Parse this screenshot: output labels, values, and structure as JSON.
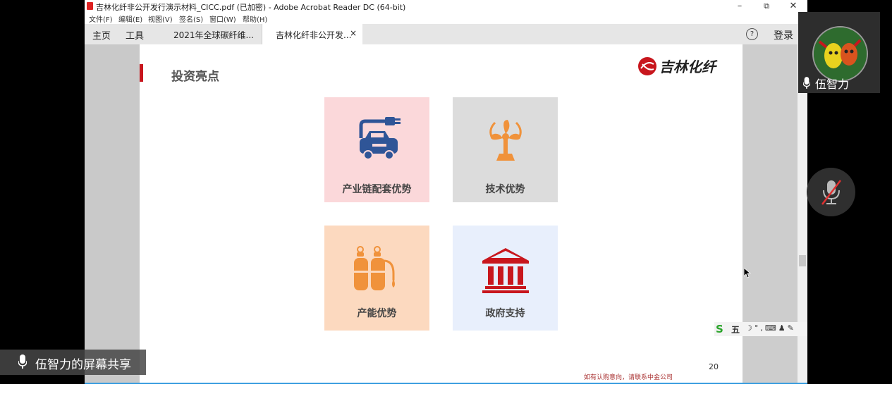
{
  "window": {
    "title": "吉林化纤非公开发行演示材料_CICC.pdf  (已加密)  - Adobe Acrobat Reader DC (64-bit)",
    "controls": {
      "minimize": "–",
      "restore": "⧉",
      "close": "✕"
    }
  },
  "menu": [
    "文件(F)",
    "编辑(E)",
    "视图(V)",
    "签名(S)",
    "窗口(W)",
    "帮助(H)"
  ],
  "toolbar": {
    "home": "主页",
    "tools": "工具",
    "help": "?",
    "login": "登录"
  },
  "tabs": [
    {
      "label": "2021年全球碳纤维..."
    },
    {
      "label": "吉林化纤非公开发...",
      "close": "×"
    }
  ],
  "page": {
    "title": "投资亮点",
    "logo_text": "吉林化纤",
    "cards": [
      {
        "label": "产业链配套优势",
        "icon": "car-charging-icon",
        "color": "#2f5597"
      },
      {
        "label": "技术优势",
        "icon": "fan-icon",
        "color": "#f0923b"
      },
      {
        "label": "产能优势",
        "icon": "gas-cylinder-icon",
        "color": "#f0923b"
      },
      {
        "label": "政府支持",
        "icon": "government-building-icon",
        "color": "#c8161d"
      }
    ],
    "footnote": "如有认购意向，请联系中金公司",
    "page_number": "20"
  },
  "ime": {
    "logo": "S",
    "mode": "五",
    "icons": "☽°,⌨♟✎"
  },
  "meeting": {
    "share_label": "伍智力的屏幕共享",
    "participant_name": "伍智力"
  }
}
